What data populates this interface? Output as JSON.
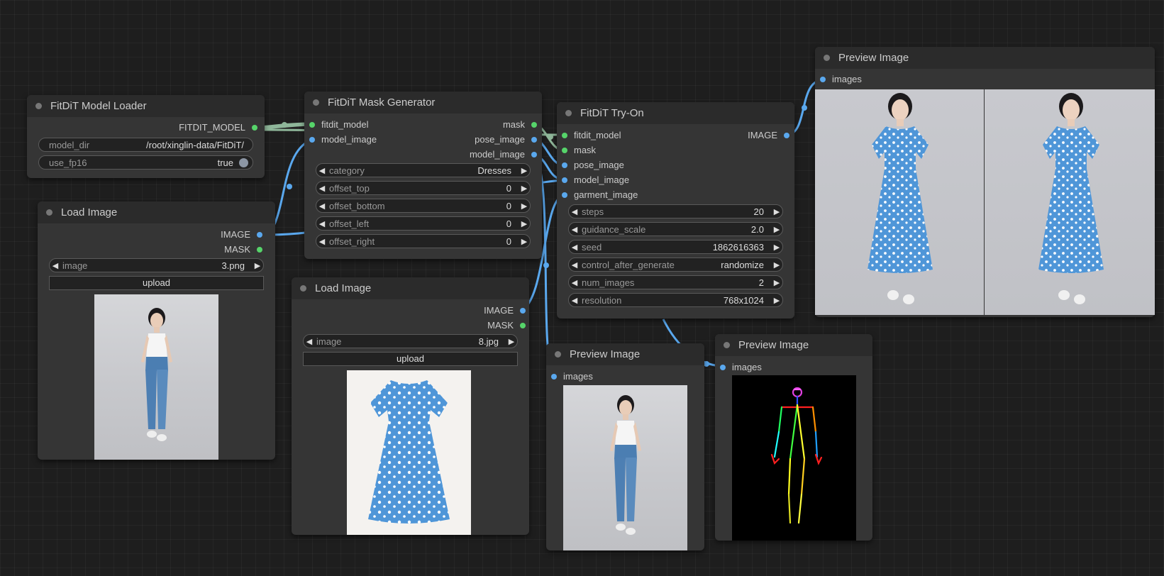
{
  "nodes": {
    "model_loader": {
      "title": "FitDiT Model Loader",
      "outputs": [
        "FITDIT_MODEL"
      ],
      "widgets": {
        "model_dir": {
          "label": "model_dir",
          "value": "/root/xinglin-data/FitDiT/"
        },
        "use_fp16": {
          "label": "use_fp16",
          "value": "true"
        }
      }
    },
    "load_image_person": {
      "title": "Load Image",
      "outputs": [
        "IMAGE",
        "MASK"
      ],
      "image_widget": {
        "label": "image",
        "value": "3.png"
      },
      "upload_label": "upload"
    },
    "mask_generator": {
      "title": "FitDiT Mask Generator",
      "inputs": [
        "fitdit_model",
        "model_image"
      ],
      "outputs": [
        "mask",
        "pose_image",
        "model_image"
      ],
      "widgets": [
        {
          "label": "category",
          "value": "Dresses"
        },
        {
          "label": "offset_top",
          "value": "0"
        },
        {
          "label": "offset_bottom",
          "value": "0"
        },
        {
          "label": "offset_left",
          "value": "0"
        },
        {
          "label": "offset_right",
          "value": "0"
        }
      ]
    },
    "load_image_garment": {
      "title": "Load Image",
      "outputs": [
        "IMAGE",
        "MASK"
      ],
      "image_widget": {
        "label": "image",
        "value": "8.jpg"
      },
      "upload_label": "upload"
    },
    "tryon": {
      "title": "FitDiT Try-On",
      "inputs": [
        "fitdit_model",
        "mask",
        "pose_image",
        "model_image",
        "garment_image"
      ],
      "outputs": [
        "IMAGE"
      ],
      "widgets": [
        {
          "label": "steps",
          "value": "20"
        },
        {
          "label": "guidance_scale",
          "value": "2.0"
        },
        {
          "label": "seed",
          "value": "1862616363"
        },
        {
          "label": "control_after_generate",
          "value": "randomize"
        },
        {
          "label": "num_images",
          "value": "2"
        },
        {
          "label": "resolution",
          "value": "768x1024"
        }
      ]
    },
    "preview_results": {
      "title": "Preview Image",
      "inputs": [
        "images"
      ]
    },
    "preview_model": {
      "title": "Preview Image",
      "inputs": [
        "images"
      ]
    },
    "preview_pose": {
      "title": "Preview Image",
      "inputs": [
        "images"
      ]
    }
  },
  "colors": {
    "canvas": "#1e1e1e",
    "node_body": "#353535",
    "node_title": "#2b2b2b",
    "wire_model": "#8fb79a",
    "wire_image": "#5aa8ee",
    "slot_model": "#56d46a",
    "slot_image": "#5aa8ee",
    "dress_blue": "#4f96d8"
  },
  "icons": {
    "widget_decrement": "◀",
    "widget_increment": "▶"
  }
}
